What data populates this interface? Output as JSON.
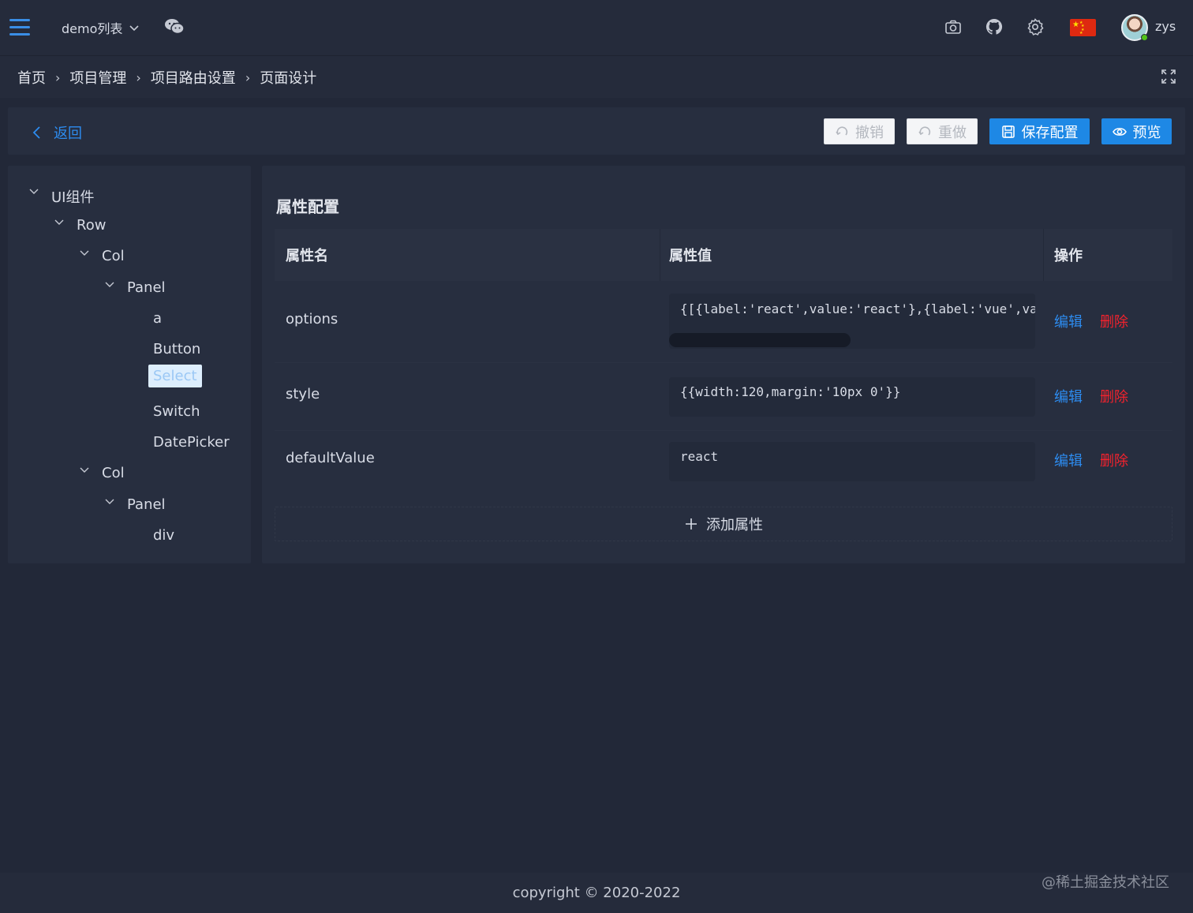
{
  "header": {
    "demo_select_label": "demo列表",
    "username": "zys",
    "icons": [
      "menu-icon",
      "chevron-down-icon",
      "wechat-icon",
      "camera-icon",
      "github-icon",
      "gear-icon",
      "china-flag-icon",
      "avatar"
    ]
  },
  "breadcrumb": {
    "items": [
      "首页",
      "项目管理",
      "项目路由设置",
      "页面设计"
    ],
    "separator": "›"
  },
  "actions": {
    "back_label": "返回",
    "undo_label": "撤销",
    "redo_label": "重做",
    "save_label": "保存配置",
    "preview_label": "预览"
  },
  "tree": {
    "nodes": [
      {
        "label": "UI组件",
        "expanded": true
      },
      {
        "label": "Row",
        "expanded": true
      },
      {
        "label": "Col",
        "expanded": true
      },
      {
        "label": "Panel",
        "expanded": true
      },
      {
        "label": "a"
      },
      {
        "label": "Button"
      },
      {
        "label": "Select",
        "selected": true
      },
      {
        "label": "Switch"
      },
      {
        "label": "DatePicker"
      },
      {
        "label": "Col",
        "expanded": true
      },
      {
        "label": "Panel",
        "expanded": true
      },
      {
        "label": "div"
      }
    ]
  },
  "props": {
    "title": "属性配置",
    "columns": [
      "属性名",
      "属性值",
      "操作"
    ],
    "rows": [
      {
        "name": "options",
        "value": "{[{label:'react',value:'react'},{label:'vue',value:'vue'}]}"
      },
      {
        "name": "style",
        "value": "{{width:120,margin:'10px 0'}}"
      },
      {
        "name": "defaultValue",
        "value": "react"
      }
    ],
    "edit_label": "编辑",
    "delete_label": "删除",
    "add_label": "添加属性"
  },
  "footer": {
    "copyright": "copyright © 2020-2022"
  },
  "watermark": "@稀土掘金技术社区",
  "colors": {
    "accent": "#1e88e5",
    "link": "#2d8cf0",
    "danger": "#f5222d",
    "background": "#222838"
  }
}
